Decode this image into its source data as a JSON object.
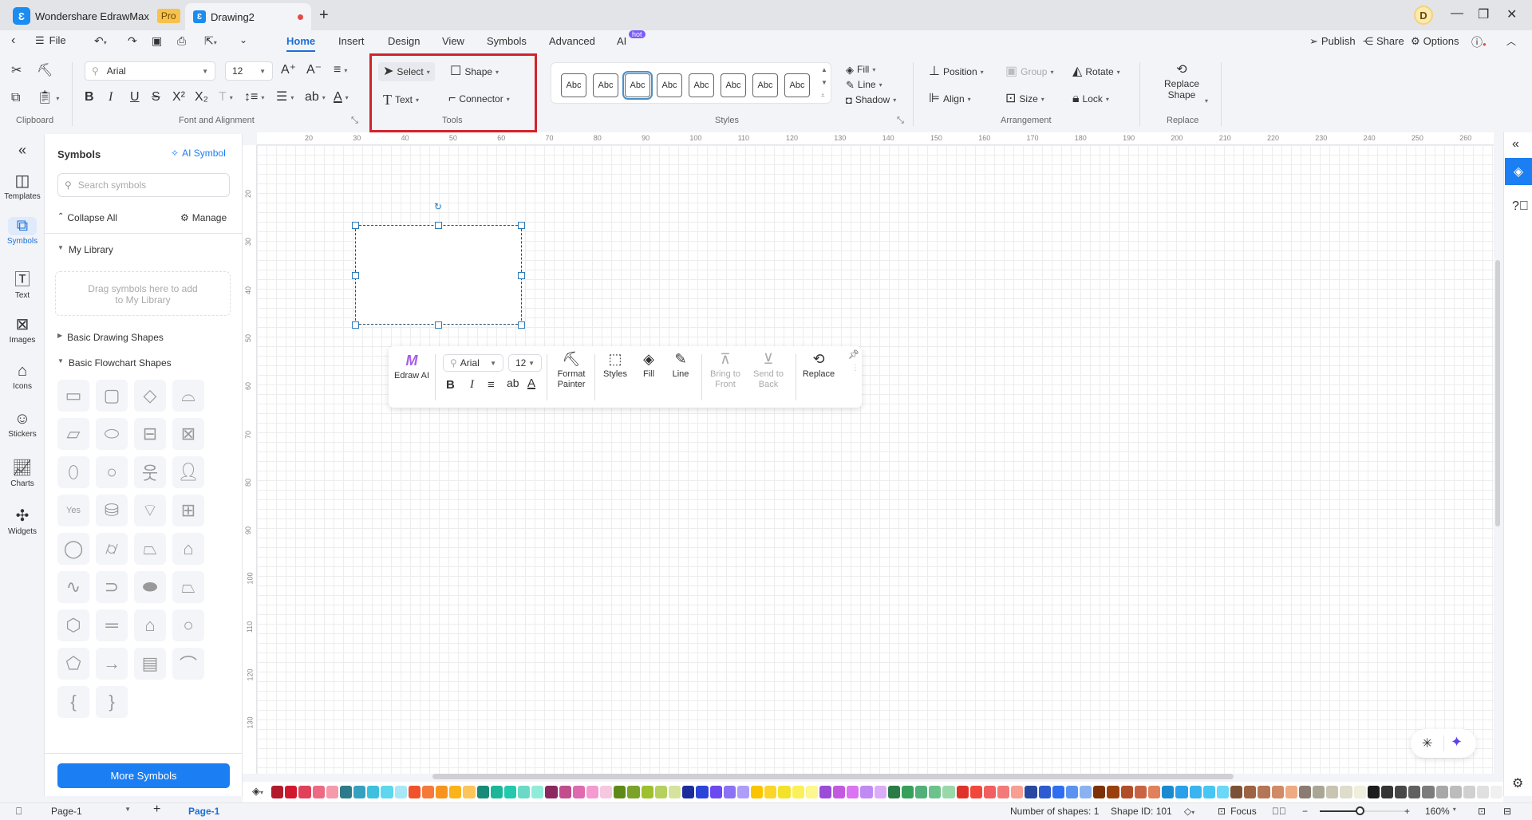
{
  "titlebar": {
    "app_name": "Wondershare EdrawMax",
    "badge": "Pro",
    "doc_tab": "Drawing2",
    "avatar_letter": "D"
  },
  "menu": {
    "file": "File",
    "tabs": [
      "Home",
      "Insert",
      "Design",
      "View",
      "Symbols",
      "Advanced",
      "AI"
    ],
    "active_tab": "Home",
    "ai_badge": "hot",
    "publish": "Publish",
    "share": "Share",
    "options": "Options"
  },
  "ribbon": {
    "clipboard_label": "Clipboard",
    "font_group_label": "Font and Alignment",
    "font_name": "Arial",
    "font_size": "12",
    "tools_label": "Tools",
    "select": "Select",
    "shape": "Shape",
    "text": "Text",
    "connector": "Connector",
    "styles_label": "Styles",
    "style_swatch_text": "Abc",
    "fill": "Fill",
    "line": "Line",
    "shadow": "Shadow",
    "arrangement_label": "Arrangement",
    "position": "Position",
    "group": "Group",
    "rotate": "Rotate",
    "align": "Align",
    "size": "Size",
    "lock": "Lock",
    "replace_shape_1": "Replace",
    "replace_shape_2": "Shape",
    "replace_label": "Replace"
  },
  "leftbar": {
    "items": [
      "Templates",
      "Symbols",
      "Text",
      "Images",
      "Icons",
      "Stickers",
      "Charts",
      "Widgets"
    ],
    "active": "Symbols"
  },
  "symbols_panel": {
    "title": "Symbols",
    "ai_symbol": "AI Symbol",
    "search_placeholder": "Search symbols",
    "collapse_all": "Collapse All",
    "manage": "Manage",
    "my_library": "My Library",
    "drop_hint_1": "Drag symbols here to add",
    "drop_hint_2": "to My Library",
    "basic_drawing": "Basic Drawing Shapes",
    "basic_flowchart": "Basic Flowchart Shapes",
    "yes_text": "Yes",
    "more_symbols": "More Symbols"
  },
  "rulers": {
    "h_ticks": [
      "20",
      "30",
      "40",
      "50",
      "60",
      "70",
      "80",
      "90",
      "100",
      "110",
      "120",
      "130",
      "140",
      "150",
      "160",
      "170",
      "180",
      "190",
      "200",
      "210",
      "220",
      "230",
      "240",
      "250",
      "260"
    ],
    "v_ticks": [
      "20",
      "30",
      "40",
      "50",
      "60",
      "70",
      "80",
      "90",
      "100",
      "110",
      "120",
      "130"
    ]
  },
  "floating_toolbar": {
    "edraw_ai": "Edraw AI",
    "font": "Arial",
    "size": "12",
    "format_painter_1": "Format",
    "format_painter_2": "Painter",
    "styles": "Styles",
    "fill": "Fill",
    "line": "Line",
    "bring_front_1": "Bring to",
    "bring_front_2": "Front",
    "send_back_1": "Send to",
    "send_back_2": "Back",
    "replace": "Replace"
  },
  "palette": [
    "#b01a2a",
    "#d0192f",
    "#e0405a",
    "#ee6a82",
    "#f59aab",
    "#2d7a8a",
    "#35a0bf",
    "#3cc0de",
    "#5ed6ee",
    "#a8e8f6",
    "#f0522a",
    "#f57a3a",
    "#f7941d",
    "#fbb31b",
    "#fcc55c",
    "#178a78",
    "#1db597",
    "#22c9ad",
    "#6ad9c6",
    "#90ecd8",
    "#8c2860",
    "#c24c8c",
    "#de6aaf",
    "#f59ad0",
    "#f5c8e0",
    "#5f8a1a",
    "#7ba32a",
    "#9dc02c",
    "#b6d060",
    "#d6e39e",
    "#1c2c9c",
    "#2c44d8",
    "#6a4af0",
    "#8b72f4",
    "#ae9ef8",
    "#fbc400",
    "#fcd52a",
    "#f2e22a",
    "#fcf05a",
    "#fcf78e",
    "#9b4bd8",
    "#c25ae0",
    "#da74f2",
    "#c08af4",
    "#dcacf8",
    "#2a7c46",
    "#36a05a",
    "#54b07a",
    "#6cc28a",
    "#9ad8aa",
    "#e0322a",
    "#f0483a",
    "#f06060",
    "#f47a7a",
    "#f89e92",
    "#2a48a0",
    "#2f5ad0",
    "#2f6ef0",
    "#5a92f2",
    "#8ab2f2",
    "#7c3206",
    "#9a400e",
    "#b04e2a",
    "#c86444",
    "#e0805c",
    "#1a8ad0",
    "#2aa0ea",
    "#3ab4f0",
    "#46c6f2",
    "#6ad8f6",
    "#7c5236",
    "#9c6444",
    "#b47656",
    "#d08a66",
    "#eeaa80",
    "#8a7c72",
    "#aaa696",
    "#c8c4b2",
    "#e0dccc",
    "#f0eedc",
    "#1c1c1c",
    "#343434",
    "#484848",
    "#606060",
    "#7c7c7c",
    "#a8a8a8",
    "#bcbcbc",
    "#d0d0d0",
    "#e0e0e0",
    "#f0f0f0"
  ],
  "statusbar": {
    "page_selector": "Page-1",
    "page_tab": "Page-1",
    "num_shapes": "Number of shapes: 1",
    "shape_id": "Shape ID: 101",
    "focus": "Focus",
    "zoom": "160%",
    "zoom_fraction": 0.45
  },
  "colors": {
    "accent": "#1b6fd6",
    "highlight_box": "#d0242b",
    "primary_button": "#1b7ef2"
  }
}
